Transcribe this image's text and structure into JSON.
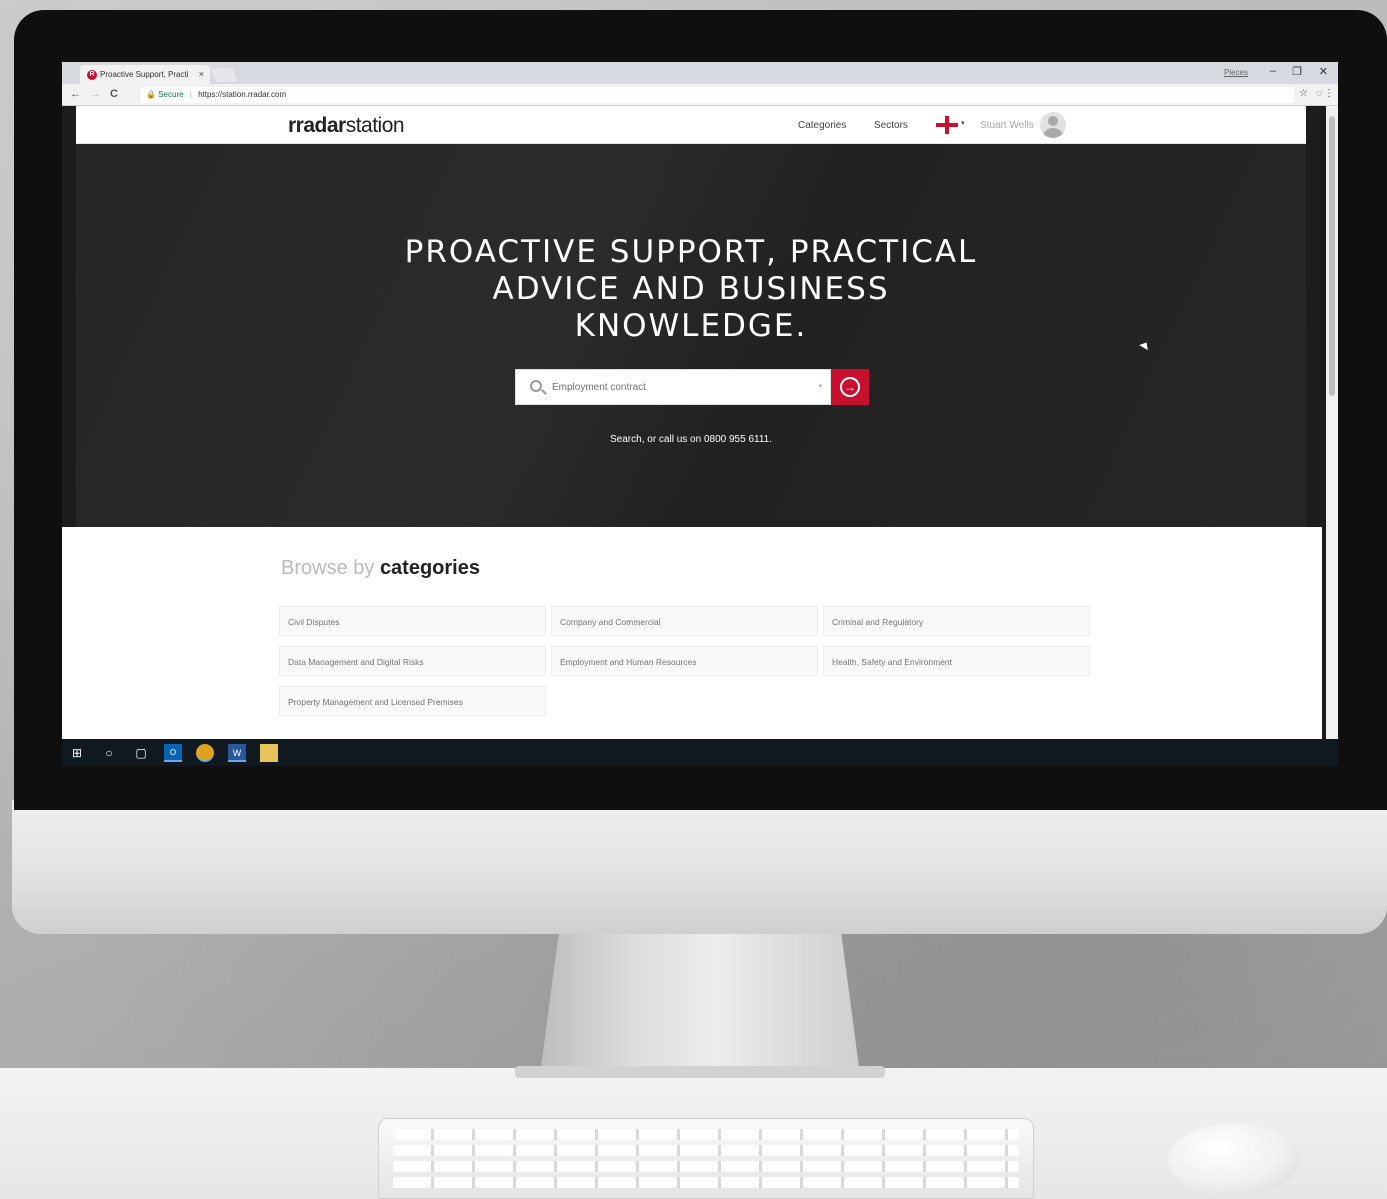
{
  "browser": {
    "tab_title": "Proactive Support, Practi",
    "tab_close": "×",
    "window_user": "Pieces",
    "minimize": "–",
    "restore": "❐",
    "close": "✕",
    "back": "←",
    "forward": "→",
    "reload": "C",
    "secure_label": "Secure",
    "url": "https://station.rradar.com",
    "star": "☆",
    "ext": "◌",
    "menu": "⋮"
  },
  "header": {
    "logo_bold": "rradar",
    "logo_light": "station",
    "nav": [
      "Categories",
      "Sectors"
    ],
    "flag_caret": "▾",
    "user_name": "Stuart Wells"
  },
  "hero": {
    "title": "PROACTIVE SUPPORT, PRACTICAL ADVICE AND BUSINESS KNOWLEDGE.",
    "search_placeholder": "Employment contract",
    "search_caret": "▾",
    "go_glyph": "→",
    "subtext": "Search, or call us on 0800 955 6111."
  },
  "categories": {
    "title_light": "Browse by ",
    "title_bold": "categories",
    "items": [
      "Civil Disputes",
      "Company and Commercial",
      "Criminal and Regulatory",
      "Data Management and Digital Risks",
      "Employment and Human Resources",
      "Health, Safety and Environment",
      "Property Management and Licensed Premises"
    ]
  },
  "taskbar": {
    "icons": [
      "windows-start-icon",
      "cortana-icon",
      "task-view-icon",
      "outlook-icon",
      "chrome-icon",
      "word-icon",
      "file-explorer-icon"
    ]
  },
  "colors": {
    "accent": "#c8102e",
    "hero_bg": "#262626"
  }
}
